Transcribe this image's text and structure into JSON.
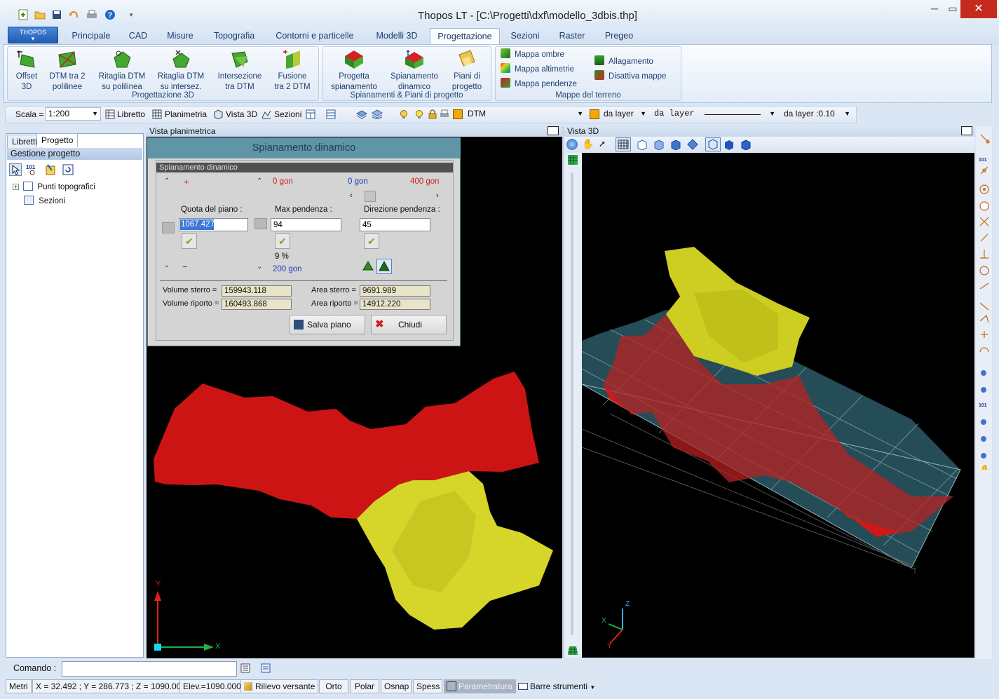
{
  "window": {
    "title": "Thopos LT - [C:\\Progetti\\dxf\\modello_3dbis.thp]"
  },
  "app_button": {
    "label": "THOPOS"
  },
  "tabs": [
    "Principale",
    "CAD",
    "Misure",
    "Topografia",
    "Contorni e particelle",
    "Modelli 3D",
    "Progettazione",
    "Sezioni",
    "Raster",
    "Pregeo"
  ],
  "active_tab": "Progettazione",
  "ribbon": {
    "groups": [
      {
        "label": "Progettazione 3D",
        "buttons": [
          {
            "l1": "Offset",
            "l2": "3D"
          },
          {
            "l1": "DTM tra 2",
            "l2": "polilinee"
          },
          {
            "l1": "Ritaglia DTM",
            "l2": "su polilinea"
          },
          {
            "l1": "Ritaglia DTM",
            "l2": "su intersez."
          },
          {
            "l1": "Intersezione",
            "l2": "tra DTM"
          },
          {
            "l1": "Fusione",
            "l2": "tra 2 DTM"
          }
        ]
      },
      {
        "label": "Spianamenti & Piani di progetto",
        "buttons": [
          {
            "l1": "Progetta",
            "l2": "spianamento"
          },
          {
            "l1": "Spianamento",
            "l2": "dinamico"
          },
          {
            "l1": "Piani di",
            "l2": "progetto"
          }
        ]
      },
      {
        "label": "Mappe del terreno",
        "small": [
          "Mappa ombre",
          "Mappa altimetrie",
          "Mappa pendenze",
          "Allagamento",
          "Disattiva mappe"
        ]
      }
    ]
  },
  "toolbar": {
    "scala_label": "Scala =",
    "scala_value": "1:200",
    "libretto": "Libretto",
    "planimetria": "Planimetria",
    "vista3d": "Vista 3D",
    "sezioni": "Sezioni",
    "layer": "DTM",
    "color_by": "da layer",
    "linetype": "da layer",
    "lineweight": "da layer :0.10",
    "layer_color": "#f7a600"
  },
  "left_panel": {
    "tabs": [
      "Libretti",
      "Progetto"
    ],
    "active_tab": "Progetto",
    "header": "Gestione progetto",
    "tree": [
      "Punti topografici",
      "Sezioni"
    ]
  },
  "plan_view": {
    "title": "Vista planimetrica",
    "axis_x": "X",
    "axis_y": "Y"
  },
  "view3d": {
    "title": "Vista 3D",
    "axis_x": "X",
    "axis_y": "Y",
    "axis_z": "Z"
  },
  "dialog": {
    "title": "Spianamento dinamico",
    "subtitle": "Spianamento dinamico",
    "plus": "+",
    "minus": "−",
    "angle_top_left": "0 gon",
    "angle_top_mid": "0 gon",
    "angle_top_right": "400 gon",
    "quota_label": "Quota del piano :",
    "quota_value": "1067.427",
    "pend_label": "Max pendenza :",
    "pend_value": "94",
    "pend_pct": "9 %",
    "pend_bottom": "200 gon",
    "dir_label": "Direzione pendenza :",
    "dir_value": "45",
    "vol_sterro_label": "Volume sterro =",
    "vol_sterro": "159943.118",
    "vol_riporto_label": "Volume riporto =",
    "vol_riporto": "160493.868",
    "area_sterro_label": "Area sterro =",
    "area_sterro": "9691.989",
    "area_riporto_label": "Area riporto =",
    "area_riporto": "14912.220",
    "salva": "Salva piano",
    "chiudi": "Chiudi"
  },
  "command": {
    "label": "Comando :",
    "value": ""
  },
  "status": {
    "units": "Metri",
    "coords": "X = 32.492 ; Y = 286.773 ; Z = 1090.000",
    "elev": "Elev.=1090.000",
    "rilievo": "Rilievo versante",
    "orto": "Orto",
    "polar": "Polar",
    "osnap": "Osnap",
    "spess": "Spess",
    "param": "Parametratura",
    "barre": "Barre strumenti"
  }
}
